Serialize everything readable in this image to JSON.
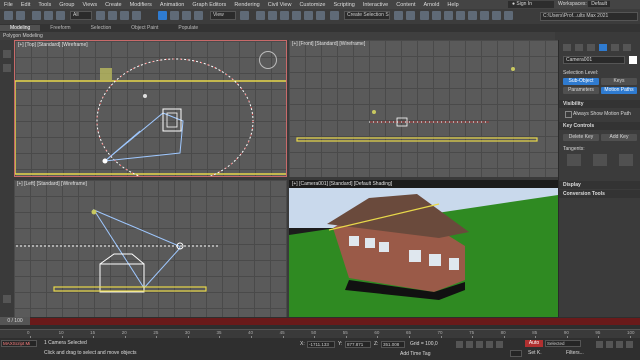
{
  "menu": [
    "File",
    "Edit",
    "Tools",
    "Group",
    "Views",
    "Create",
    "Modifiers",
    "Animation",
    "Graph Editors",
    "Rendering",
    "Civil View",
    "Customize",
    "Scripting",
    "Interactive",
    "Content",
    "Arnold",
    "Help"
  ],
  "account": {
    "sign_in": "Sign In",
    "workspaces_label": "Workspaces:",
    "workspace_value": "Default"
  },
  "toolbar": {
    "filter_value": "All",
    "view_value": "View",
    "selection_set_placeholder": "Create Selection Set",
    "path_value": "C:\\Users\\Prof...ults Max 2021"
  },
  "ribbon": {
    "tabs": [
      "Modeling",
      "Freeform",
      "Selection",
      "Object Paint",
      "Populate"
    ],
    "sub_label": "Polygon Modeling"
  },
  "viewports": {
    "top": {
      "label": "[+] [Top] [Standard] [Wireframe]"
    },
    "front": {
      "label": "[+] [Front] [Standard] [Wireframe]"
    },
    "left": {
      "label": "[+] [Left] [Standard] [Wireframe]"
    },
    "camera": {
      "label": "[+] [Camera001] [Standard] [Default Shading]"
    }
  },
  "command_panel": {
    "object_name": "Camera001",
    "selection_level_label": "Selection Level:",
    "sub_object": "Sub-Object",
    "keys": "Keys",
    "parameters": "Parameters",
    "motion_paths": "Motion Paths",
    "visibility_label": "Visibility",
    "always_show": "Always Show Motion Path",
    "key_controls_label": "Key Controls",
    "delete_key": "Delete Key",
    "add_key": "Add Key",
    "tangents_label": "Tangents:",
    "display_label": "Display",
    "conversion_tools_label": "Conversion Tools"
  },
  "timeline": {
    "slider_value": "0 / 100",
    "ticks": [
      "0",
      "10",
      "15",
      "20",
      "25",
      "30",
      "35",
      "40",
      "45",
      "50",
      "55",
      "60",
      "65",
      "70",
      "75",
      "80",
      "85",
      "90",
      "95",
      "100"
    ]
  },
  "status": {
    "script_label": "MAXScript Mi",
    "selected_text": "1 Camera Selected",
    "prompt_text": "Click and drag to select and move objects",
    "x_label": "X:",
    "x_value": "-1711.133",
    "y_label": "Y:",
    "y_value": "877.871",
    "z_label": "Z:",
    "z_value": "351.008",
    "grid_text": "Grid = 100,0",
    "add_time_tag": "Add Time Tag",
    "auto": "Auto",
    "selected": "Selected",
    "set_k": "Set K.",
    "filters": "Filters..."
  },
  "colors": {
    "accent": "#2f7bd0",
    "timebar": "#6a1a1a",
    "active_border": "#c86a6a",
    "grass": "#2f8a22",
    "sky": "#c9d9ec",
    "brick": "#9a5a48"
  }
}
